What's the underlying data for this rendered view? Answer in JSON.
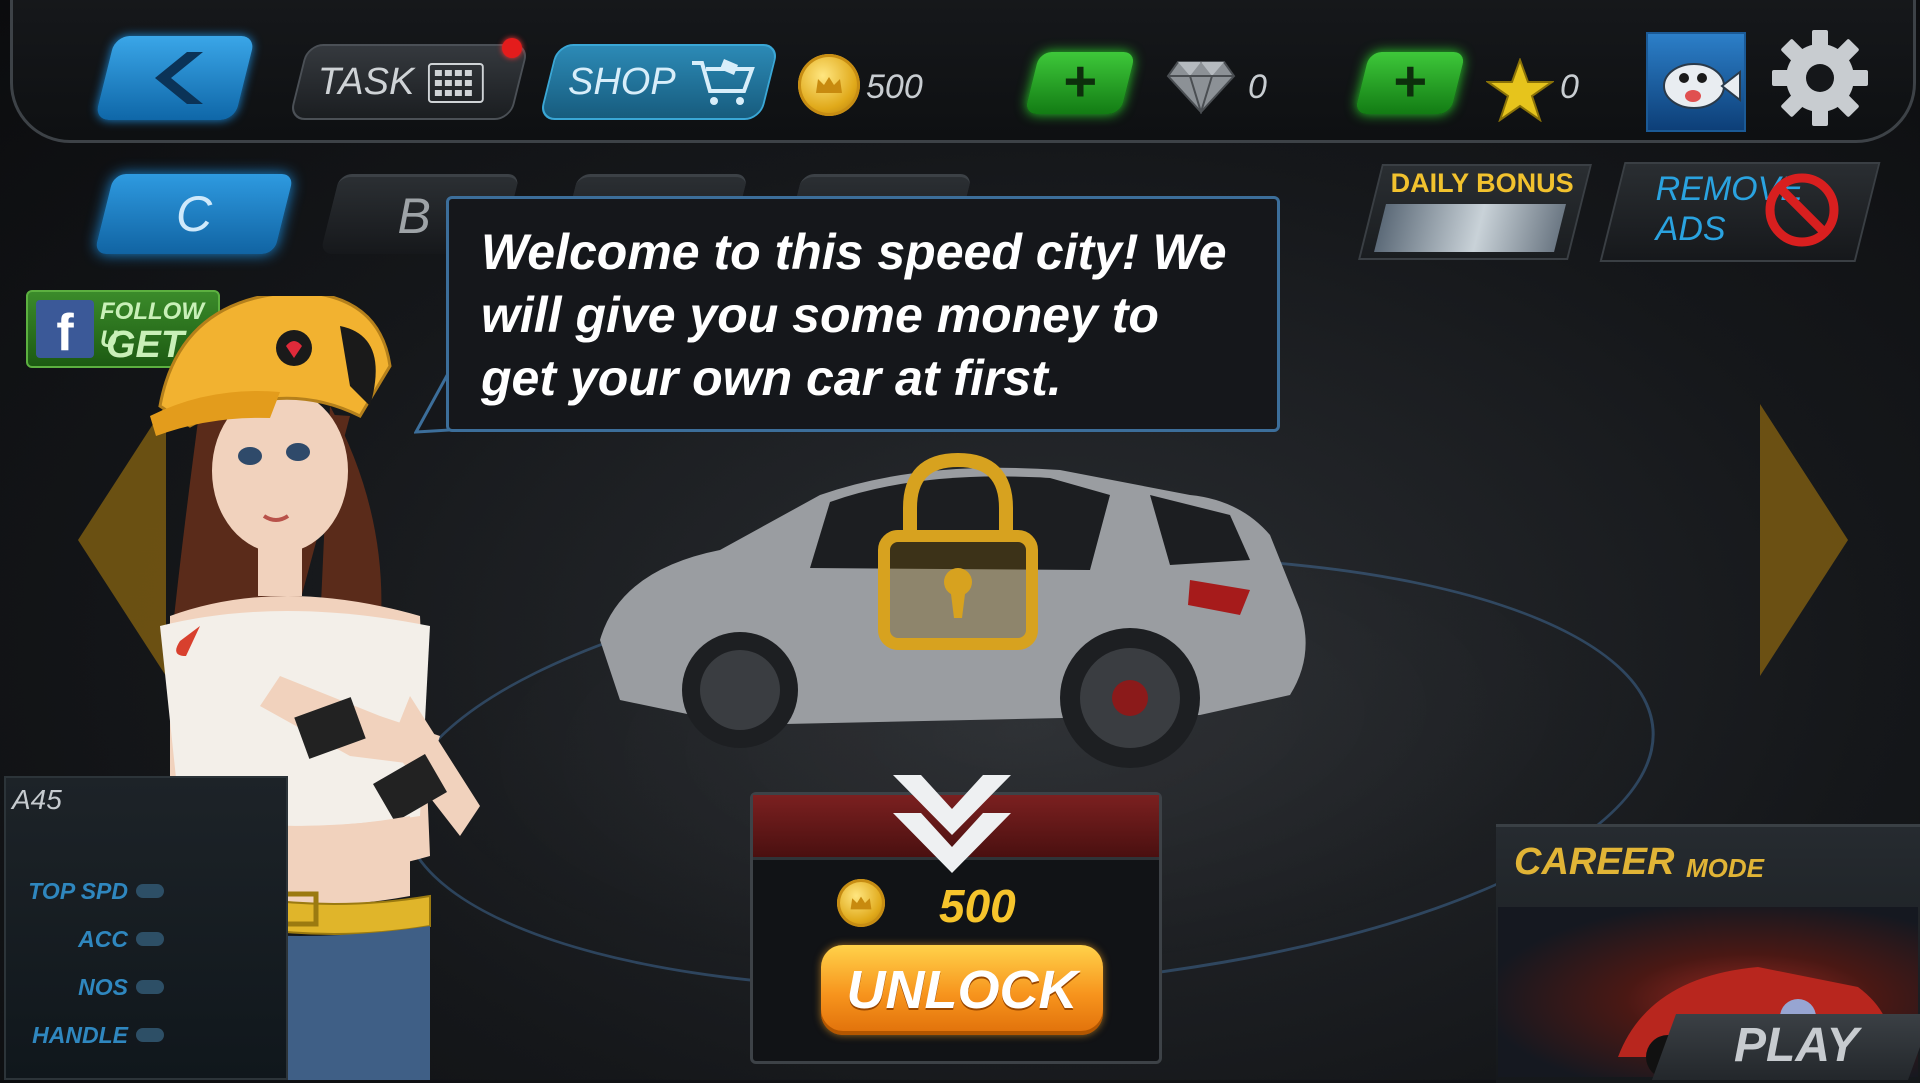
{
  "topbar": {
    "task_label": "TASK",
    "shop_label": "SHOP",
    "coins": "500",
    "gems": "0",
    "stars": "0"
  },
  "tabs": [
    {
      "label": "C"
    },
    {
      "label": "B"
    },
    {
      "label": ""
    },
    {
      "label": ""
    }
  ],
  "daily_bonus": {
    "label": "DAILY BONUS"
  },
  "remove_ads": {
    "line1": "REMOVE",
    "line2": "ADS"
  },
  "facebook": {
    "follow_label": "FOLLOW U",
    "get_label": "GET"
  },
  "speech": {
    "text": "Welcome to this speed city! We will give you some money to get your own car at first."
  },
  "car": {
    "name": "A45",
    "stats": [
      {
        "label": "TOP SPD",
        "level": 0.2
      },
      {
        "label": "ACC",
        "level": 0.2
      },
      {
        "label": "NOS",
        "level": 0.2
      },
      {
        "label": "HANDLE",
        "level": 0.2
      }
    ]
  },
  "unlock": {
    "price": "500",
    "button_label": "UNLOCK"
  },
  "career": {
    "title": "CAREER",
    "mode_word": "MODE",
    "play_label": "PLAY"
  },
  "colors": {
    "accent_blue": "#1c8ad8",
    "accent_green": "#2bd12b",
    "gold": "#f6c42c",
    "unlock_orange": "#f7941d"
  },
  "icons": [
    "back-arrow-icon",
    "task-grid-icon",
    "shop-cart-icon",
    "coin-icon",
    "plus-icon",
    "diamond-icon",
    "star-icon",
    "gear-icon",
    "no-sign-icon",
    "facebook-icon",
    "lock-icon",
    "chevron-down-icon"
  ]
}
